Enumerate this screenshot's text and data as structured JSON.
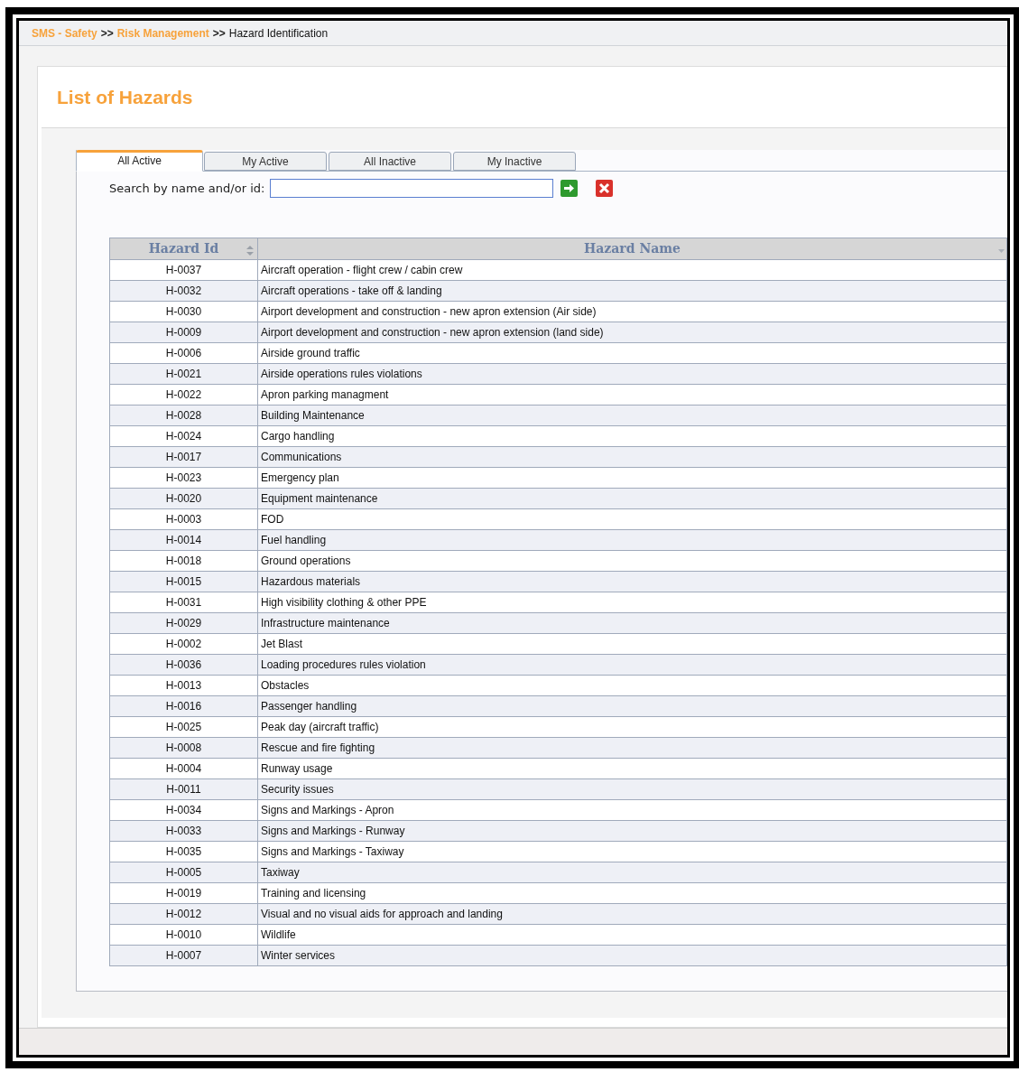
{
  "breadcrumb": [
    {
      "label": "SMS - Safety",
      "kind": "link"
    },
    {
      "label": ">>",
      "kind": "separator"
    },
    {
      "label": "Risk Management",
      "kind": "link"
    },
    {
      "label": ">>",
      "kind": "separator"
    },
    {
      "label": "Hazard Identification",
      "kind": "current"
    }
  ],
  "page_title": "List of Hazards",
  "tabs": [
    {
      "label": "All Active",
      "selected": true
    },
    {
      "label": "My Active",
      "selected": false
    },
    {
      "label": "All Inactive",
      "selected": false
    },
    {
      "label": "My Inactive",
      "selected": false
    }
  ],
  "search": {
    "label": "Search by name and/or id:"
  },
  "table": {
    "columns": [
      "Hazard Id",
      "Hazard Name"
    ],
    "rows": [
      [
        "H-0037",
        "Aircraft operation - flight crew / cabin crew"
      ],
      [
        "H-0032",
        "Aircraft operations - take off & landing"
      ],
      [
        "H-0030",
        "Airport development and construction - new apron extension (Air side)"
      ],
      [
        "H-0009",
        "Airport development and construction - new apron extension (land side)"
      ],
      [
        "H-0006",
        "Airside ground traffic"
      ],
      [
        "H-0021",
        "Airside operations rules violations"
      ],
      [
        "H-0022",
        "Apron parking managment"
      ],
      [
        "H-0028",
        "Building Maintenance"
      ],
      [
        "H-0024",
        "Cargo handling"
      ],
      [
        "H-0017",
        "Communications"
      ],
      [
        "H-0023",
        "Emergency plan"
      ],
      [
        "H-0020",
        "Equipment maintenance"
      ],
      [
        "H-0003",
        "FOD"
      ],
      [
        "H-0014",
        "Fuel handling"
      ],
      [
        "H-0018",
        "Ground operations"
      ],
      [
        "H-0015",
        "Hazardous materials"
      ],
      [
        "H-0031",
        "High visibility clothing & other PPE"
      ],
      [
        "H-0029",
        "Infrastructure maintenance"
      ],
      [
        "H-0002",
        "Jet Blast"
      ],
      [
        "H-0036",
        "Loading procedures rules violation"
      ],
      [
        "H-0013",
        "Obstacles"
      ],
      [
        "H-0016",
        "Passenger handling"
      ],
      [
        "H-0025",
        "Peak day (aircraft traffic)"
      ],
      [
        "H-0008",
        "Rescue and fire fighting"
      ],
      [
        "H-0004",
        "Runway usage"
      ],
      [
        "H-0011",
        "Security issues"
      ],
      [
        "H-0034",
        "Signs and Markings - Apron"
      ],
      [
        "H-0033",
        "Signs and Markings - Runway"
      ],
      [
        "H-0035",
        "Signs and Markings - Taxiway"
      ],
      [
        "H-0005",
        "Taxiway"
      ],
      [
        "H-0019",
        "Training and licensing"
      ],
      [
        "H-0012",
        "Visual and no visual aids for approach and landing"
      ],
      [
        "H-0010",
        "Wildlife"
      ],
      [
        "H-0007",
        "Winter services"
      ]
    ]
  }
}
